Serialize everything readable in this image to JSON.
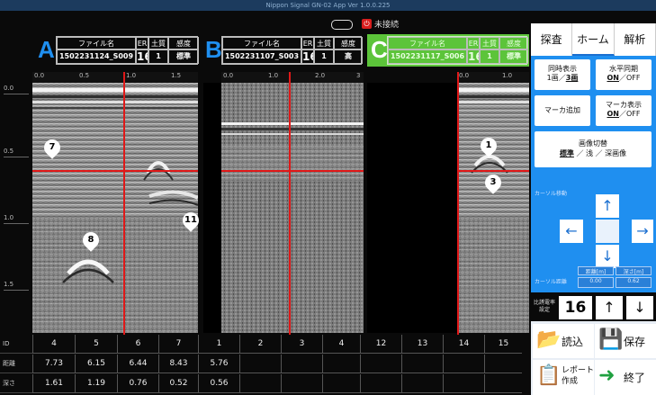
{
  "window": {
    "title": "Nippon Signal GN-02 App Ver 1.0.0.225"
  },
  "status": {
    "connection": "未接続",
    "power_glyph": "⏻"
  },
  "panels": [
    {
      "letter": "A",
      "color": "#1f8ff0",
      "hdr_bg": "#0a0a0a",
      "file_label": "ファイル名",
      "file_value": "1502231124_S009",
      "er_label": "ER",
      "er_value": "16",
      "soil_label": "土質",
      "soil_value": "1",
      "sens_label": "感度",
      "sens_value": "標準",
      "ticks": [
        "0.0",
        "0.5",
        "1.0",
        "1.5"
      ]
    },
    {
      "letter": "B",
      "color": "#1f8ff0",
      "hdr_bg": "#0a0a0a",
      "file_label": "ファイル名",
      "file_value": "1502231107_S003",
      "er_label": "ER",
      "er_value": "16",
      "soil_label": "土質",
      "soil_value": "1",
      "sens_label": "感度",
      "sens_value": "高",
      "ticks": [
        "0.0",
        "1.0",
        "2.0",
        "3"
      ]
    },
    {
      "letter": "C",
      "color": "#ffffff",
      "hdr_bg": "#5cc43a",
      "file_label": "ファイル名",
      "file_value": "1502231117_S006",
      "er_label": "ER",
      "er_value": "16",
      "soil_label": "土質",
      "soil_value": "1",
      "sens_label": "感度",
      "sens_value": "標準",
      "ticks": [
        "0.0",
        "1.0"
      ]
    }
  ],
  "depth_axis": [
    "0.0",
    "0.5",
    "1.0",
    "1.5"
  ],
  "markers": [
    {
      "num": "7"
    },
    {
      "num": "8"
    },
    {
      "num": "11"
    },
    {
      "num": "1"
    },
    {
      "num": "3"
    }
  ],
  "table": {
    "labels": [
      "ID",
      "距離",
      "深さ"
    ],
    "ids": [
      "4",
      "5",
      "6",
      "7",
      "1",
      "2",
      "3",
      "4",
      "12",
      "13",
      "14",
      "15"
    ],
    "distances": [
      "7.73",
      "6.15",
      "6.44",
      "8.43",
      "5.76",
      "",
      "",
      "",
      "",
      "",
      "",
      ""
    ],
    "depths": [
      "1.61",
      "1.19",
      "0.76",
      "0.52",
      "0.56",
      "",
      "",
      "",
      "",
      "",
      "",
      ""
    ]
  },
  "side": {
    "tabs": [
      "探査",
      "ホーム",
      "解析"
    ],
    "active_tab": "ホーム",
    "btn_sim": {
      "l1": "同時表示",
      "l2a": "1画／",
      "l2b": "3画"
    },
    "btn_hsync": {
      "l1": "水平同期",
      "l2a": "ON",
      "l2b": "／OFF"
    },
    "btn_addmarker": "マーカ追加",
    "btn_markerdisp": {
      "l1": "マーカ表示",
      "l2a": "ON",
      "l2b": "／OFF"
    },
    "btn_imgswitch": {
      "l1": "画像切替",
      "l2a": "標準",
      "l2b": " ／ 浅 ／ 深画像"
    },
    "move_label": "カーソル移動",
    "dist_label": "カーソル距離",
    "read_hdr": [
      "距離[m]",
      "深さ[m]"
    ],
    "read_val": [
      "0.00",
      "0.62"
    ],
    "arrows": {
      "up": "↑",
      "down": "↓",
      "left": "←",
      "right": "→"
    },
    "depth_label": "比誘電率\n設定",
    "depth_value": "16",
    "depth_up": "↑",
    "depth_down": "↓",
    "read_btn": "読込",
    "save_btn": "保存",
    "report_btn": "レポート\n作成",
    "exit_btn": "終了",
    "accent": "#1f8ff0"
  }
}
